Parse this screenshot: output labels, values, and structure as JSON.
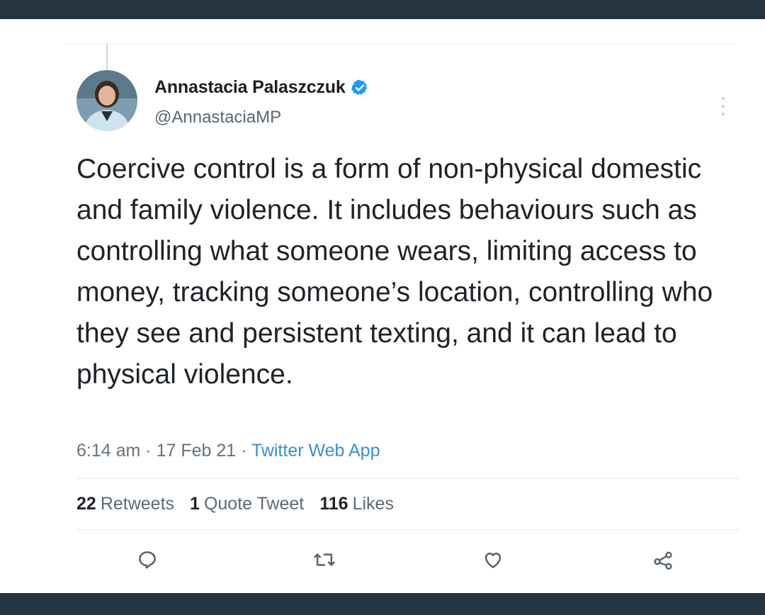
{
  "tweet": {
    "author_name": "Annastacia Palaszczuk",
    "handle": "@AnnastaciaMP",
    "text": "Coercive control is a form of non-physical domestic and family violence. It includes behaviours such as controlling what someone wears, limiting access to money, tracking someone’s location, controlling who they see and persistent texting, and it can lead to physical violence.",
    "time": "6:14 am",
    "date": "17 Feb 21",
    "source": "Twitter Web App",
    "separator": " · "
  },
  "stats": {
    "retweets_count": "22",
    "retweets_label": "Retweets",
    "quotes_count": "1",
    "quotes_label": "Quote Tweet",
    "likes_count": "116",
    "likes_label": "Likes"
  },
  "icons": {
    "verified": "verified-badge-icon",
    "more": "more-options-icon",
    "reply": "reply-icon",
    "retweet": "retweet-icon",
    "like": "heart-icon",
    "share": "share-icon"
  },
  "colors": {
    "accent": "#1d9bf0",
    "source_link": "#3d8fc6",
    "frame": "#253440"
  }
}
